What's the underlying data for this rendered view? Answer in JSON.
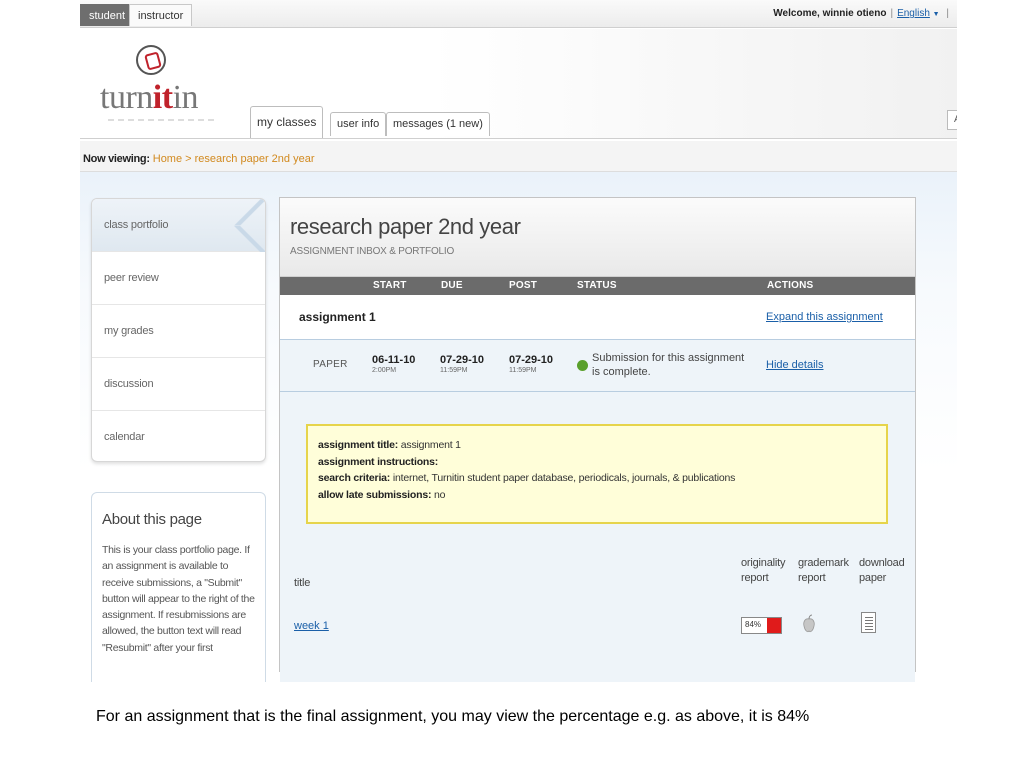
{
  "rolebar": {
    "student_tab": "student",
    "instructor_tab": "instructor",
    "welcome": "Welcome, winnie otieno",
    "language": "English"
  },
  "header": {
    "logo_prefix": "turn",
    "logo_it": "it",
    "logo_suffix": "in",
    "tabs": [
      "my classes",
      "user info",
      "messages (1 new)"
    ],
    "search_glyph": "A"
  },
  "breadcrumb": {
    "label": "Now viewing:",
    "path": "Home > research paper 2nd year"
  },
  "leftnav": {
    "items": [
      "class portfolio",
      "peer review",
      "my grades",
      "discussion",
      "calendar"
    ]
  },
  "about": {
    "title": "About this page",
    "text": "This is your class portfolio page. If an assignment is available to receive submissions, a \"Submit\" button will appear to the right of the assignment. If resubmissions are allowed, the button text will read \"Resubmit\" after your first"
  },
  "main": {
    "title": "research paper 2nd year",
    "subtitle": "ASSIGNMENT INBOX & PORTFOLIO",
    "columns": [
      "START",
      "DUE",
      "POST",
      "STATUS",
      "ACTIONS"
    ],
    "assignment": {
      "name": "assignment 1",
      "expand_link": "Expand this assignment",
      "type": "PAPER",
      "start_date": "06-11-10",
      "start_time": "2:00PM",
      "due_date": "07-29-10",
      "due_time": "11:59PM",
      "post_date": "07-29-10",
      "post_time": "11:59PM",
      "status": "Submission for this assignment is complete.",
      "status_color": "#5aa02c",
      "hide_link": "Hide details"
    },
    "details": {
      "title_label": "assignment title:",
      "title_value": " assignment 1",
      "instructions_label": "assignment instructions:",
      "criteria_label": "search criteria:",
      "criteria_value": " internet, Turnitin student paper database, periodicals, journals, & publications",
      "late_label": "allow late submissions:",
      "late_value": " no"
    },
    "table": {
      "headers": [
        "title",
        "originality report",
        "grademark report",
        "download paper"
      ],
      "rows": [
        {
          "title": "week 1",
          "originality": "84%",
          "originality_color": "#e01b1b",
          "grademark_icon": "apple-icon",
          "download_icon": "document-icon"
        }
      ]
    }
  },
  "caption": "For an assignment that is the final assignment, you may view the percentage e.g. as above, it is 84%"
}
